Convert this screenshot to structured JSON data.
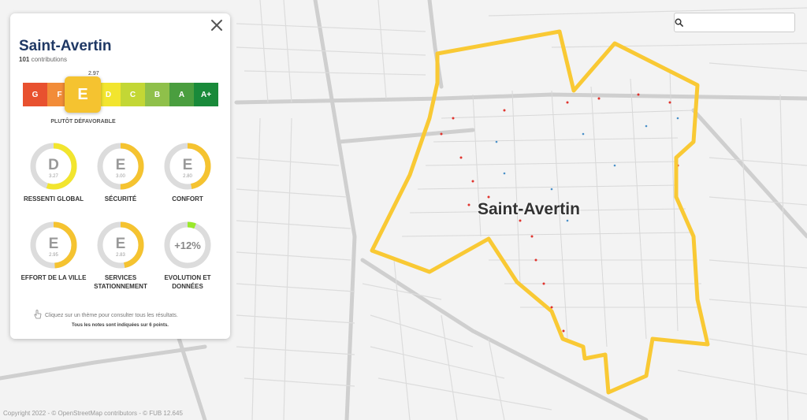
{
  "search": {
    "placeholder": ""
  },
  "panel": {
    "title": "Saint-Avertin",
    "contributions_count": "101",
    "contributions_label": "contributions",
    "scale_grades": [
      {
        "label": "G",
        "color": "#e8512f"
      },
      {
        "label": "F",
        "color": "#f28c38"
      },
      {
        "label": "E",
        "color": "#f5c330"
      },
      {
        "label": "D",
        "color": "#f2e52e"
      },
      {
        "label": "C",
        "color": "#c3d735"
      },
      {
        "label": "B",
        "color": "#8fc04a"
      },
      {
        "label": "A",
        "color": "#4a9e3f"
      },
      {
        "label": "A+",
        "color": "#198a3a"
      }
    ],
    "current_grade": "E",
    "current_score": "2.97",
    "verdict": "PLUTÔT DÉFAVORABLE",
    "themes": [
      {
        "grade": "D",
        "score": "3.27",
        "label": "RESSENTI GLOBAL",
        "fill": 0.55,
        "color": "#f2e52e"
      },
      {
        "grade": "E",
        "score": "3.00",
        "label": "SÉCURITÉ",
        "fill": 0.5,
        "color": "#f5c330"
      },
      {
        "grade": "E",
        "score": "2.80",
        "label": "CONFORT",
        "fill": 0.47,
        "color": "#f5c330"
      },
      {
        "grade": "E",
        "score": "2.95",
        "label": "EFFORT DE LA VILLE",
        "fill": 0.49,
        "color": "#f5c330"
      },
      {
        "grade": "E",
        "score": "2.83",
        "label": "SERVICES STATIONNEMENT",
        "fill": 0.47,
        "color": "#f5c330"
      },
      {
        "grade": "+12%",
        "score": "",
        "label": "EVOLUTION ET DONNÉES",
        "fill": 0.06,
        "color": "#9ae82c"
      }
    ],
    "hint": "Cliquez sur un thème pour consulter tous les résultats.",
    "note": "Tous les notes sont indiquées sur 6 points."
  },
  "map": {
    "city_label": "Saint-Avertin",
    "copyright": "Copyright 2022 - © OpenStreetMap contributors - © FUB 12.645",
    "boundary_color": "#f9c934"
  }
}
